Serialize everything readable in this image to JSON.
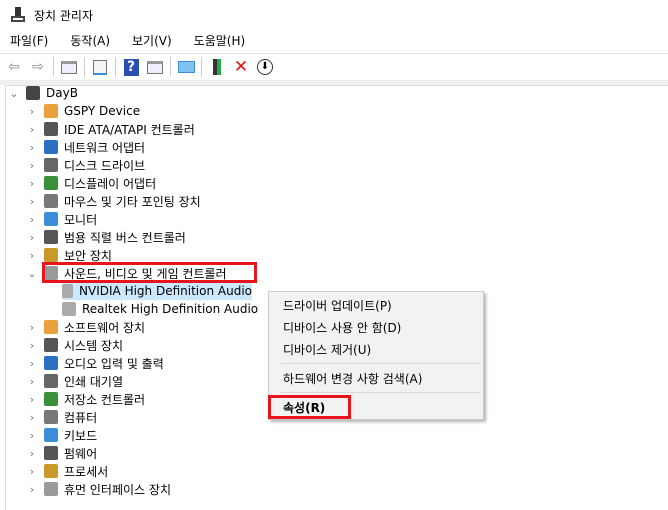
{
  "window": {
    "title": "장치 관리자"
  },
  "menu": [
    "파일(F)",
    "동작(A)",
    "보기(V)",
    "도움말(H)"
  ],
  "toolbar": {
    "icons": [
      "back-icon",
      "forward-icon",
      "show-hide-tree-icon",
      "properties-icon",
      "help-icon",
      "action-pane-icon",
      "scan-hardware-icon",
      "update-driver-icon",
      "uninstall-icon",
      "disable-icon"
    ]
  },
  "tree": {
    "root": "DayB",
    "categories": [
      "GSPY Device",
      "IDE ATA/ATAPI 컨트롤러",
      "네트워크 어댑터",
      "디스크 드라이브",
      "디스플레이 어댑터",
      "마우스 및 기타 포인팅 장치",
      "모니터",
      "범용 직렬 버스 컨트롤러",
      "보안 장치",
      "사운드, 비디오 및 게임 컨트롤러"
    ],
    "sound_children": [
      "NVIDIA High Definition Audio",
      "Realtek High Definition Audio"
    ],
    "categories_after": [
      "소프트웨어 장치",
      "시스템 장치",
      "오디오 입력 및 출력",
      "인쇄 대기열",
      "저장소 컨트롤러",
      "컴퓨터",
      "키보드",
      "펌웨어",
      "프로세서",
      "휴먼 인터페이스 장치"
    ]
  },
  "context_menu": {
    "items": [
      "드라이버 업데이트(P)",
      "디바이스 사용 안 함(D)",
      "디바이스 제거(U)",
      "하드웨어 변경 사항 검색(A)",
      "속성(R)"
    ]
  },
  "colors": {
    "highlight": "#e8141c",
    "selection": "#cce8ff"
  }
}
